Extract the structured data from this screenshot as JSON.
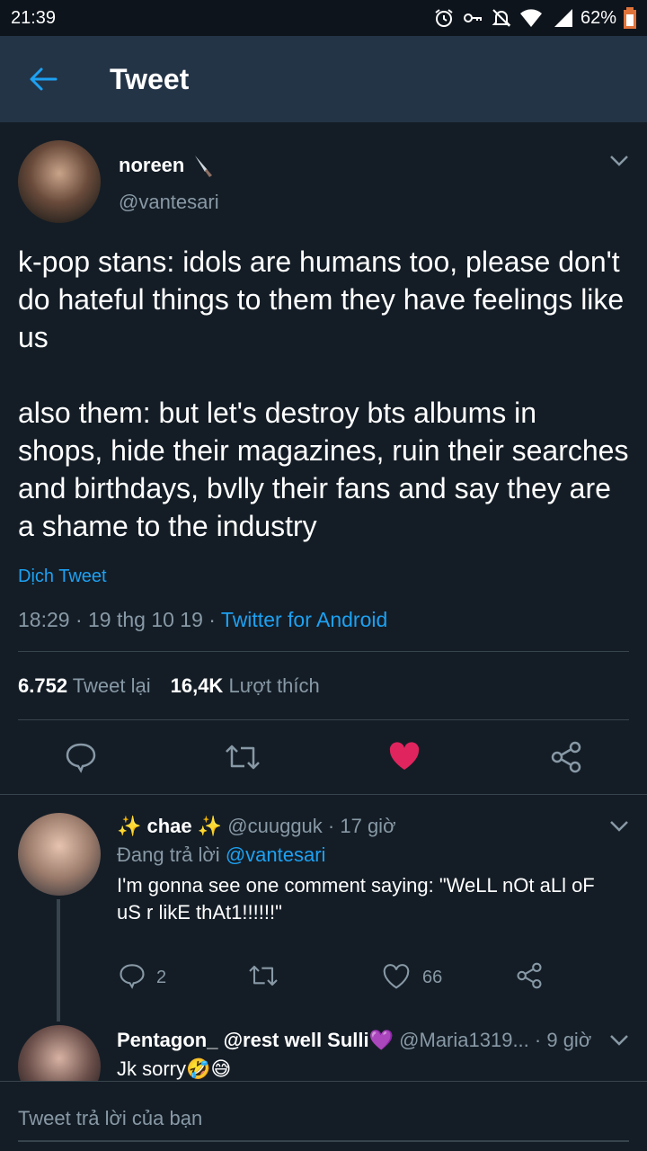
{
  "status": {
    "time": "21:39",
    "battery": "62%"
  },
  "header": {
    "title": "Tweet"
  },
  "tweet": {
    "name": "noreen",
    "handle": "@vantesari",
    "text": "k-pop stans: idols are humans too, please don't do hateful things to them they have feelings like us\n\nalso them: but let's destroy bts albums in shops, hide their magazines, ruin their searches and birthdays, bvlly their fans and say they are a shame to the industry",
    "translate": "Dịch Tweet",
    "meta_time": "18:29 · 19 thg 10 19 · ",
    "source": "Twitter for Android",
    "retweets": "6.752",
    "retweets_label": "Tweet lại",
    "likes": "16,4K",
    "likes_label": "Lượt thích",
    "liked": true
  },
  "replies": [
    {
      "name": "✨ chae ✨",
      "handle": "@cuugguk",
      "time": "· 17 giờ",
      "replying_label": "Đang trả lời ",
      "replying_to": "@vantesari",
      "text": "I'm gonna see one comment saying: \"WeLL nOt aLl oF uS r likE thAt1!!!!!!\"",
      "reply_count": "2",
      "like_count": "66"
    },
    {
      "name": "Pentagon_ @rest well Sulli💜",
      "handle": "@Maria1319...",
      "time": "· 9 giờ",
      "text": "Jk sorry🤣😅"
    }
  ],
  "composer": {
    "placeholder": "Tweet trả lời của bạn"
  },
  "colors": {
    "accent": "#1da1f2",
    "like": "#e0245e",
    "background": "#141d26",
    "bar": "#243447"
  }
}
